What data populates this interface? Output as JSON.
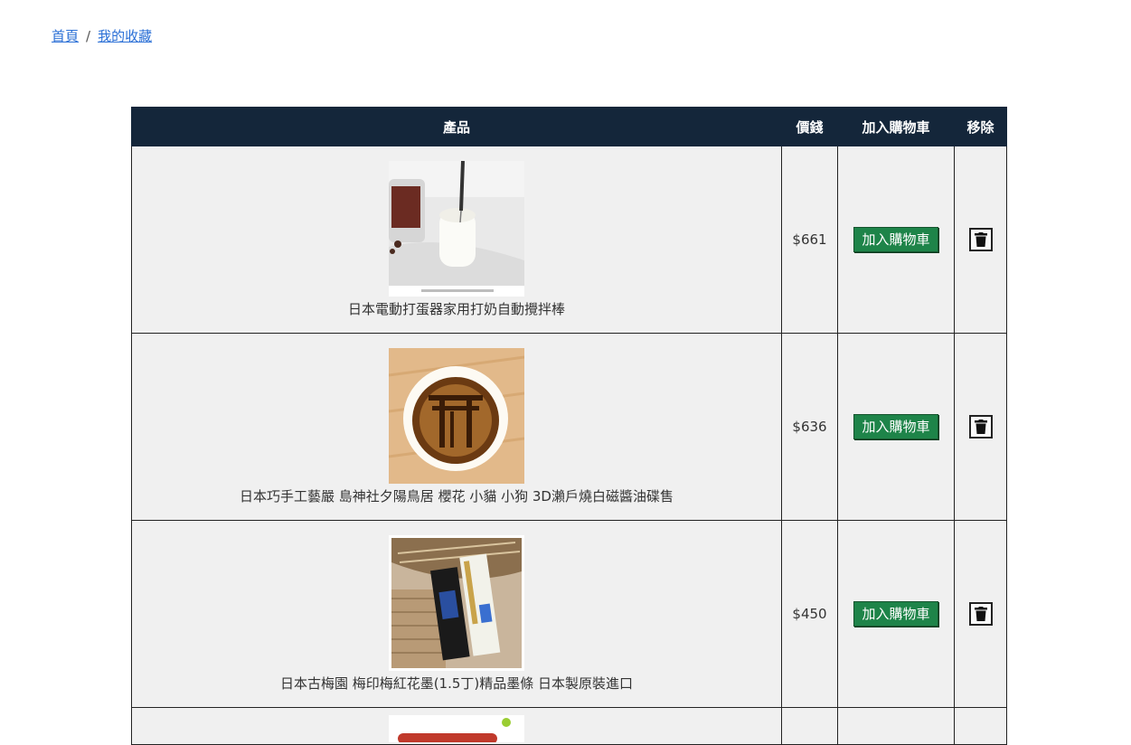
{
  "breadcrumb": {
    "home": "首頁",
    "separator": "/",
    "current": "我的收藏"
  },
  "table": {
    "headers": {
      "product": "產品",
      "price": "價錢",
      "add_to_cart": "加入購物車",
      "remove": "移除"
    },
    "rows": [
      {
        "name": "日本電動打蛋器家用打奶自動攪拌棒",
        "price": "$661",
        "cart_label": "加入購物車",
        "image": "milk-frother-photo"
      },
      {
        "name": "日本巧手工藝嚴 島神社夕陽鳥居 櫻花 小貓 小狗 3D瀨戶燒白磁醬油碟售",
        "price": "$636",
        "cart_label": "加入購物車",
        "image": "torii-soy-dish-photo"
      },
      {
        "name": "日本古梅園 梅印梅紅花墨(1.5丁)精品墨條 日本製原裝進口",
        "price": "$450",
        "cart_label": "加入購物車",
        "image": "ink-stick-photo"
      }
    ]
  },
  "icons": {
    "delete": "trash-icon"
  },
  "colors": {
    "header_bg": "#14263a",
    "cart_button": "#1e8449",
    "link": "#2a6fd6",
    "row_bg": "#f0f0f0"
  }
}
